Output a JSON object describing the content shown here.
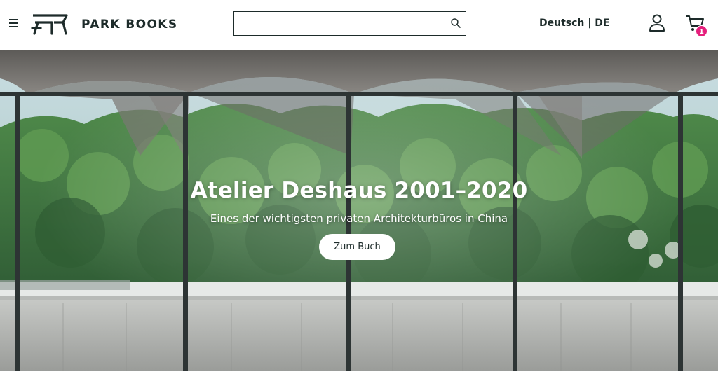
{
  "header": {
    "brand": "PARK BOOKS",
    "search": {
      "value": "",
      "placeholder": ""
    },
    "language": "Deutsch | DE",
    "cart_count": "1",
    "icons": {
      "menu": "hamburger-menu-icon",
      "logo": "park-bench-logo-icon",
      "search": "magnifier-icon",
      "account": "user-icon",
      "cart": "shopping-cart-icon"
    }
  },
  "hero": {
    "title": "Atelier Deshaus 2001–2020",
    "subtitle": "Eines der wichtigsten privaten Architekturbüros in China",
    "cta_label": "Zum Buch"
  },
  "colors": {
    "text": "#1d2b2a",
    "badge": "#e51f7c",
    "header_bg": "#ffffff"
  }
}
